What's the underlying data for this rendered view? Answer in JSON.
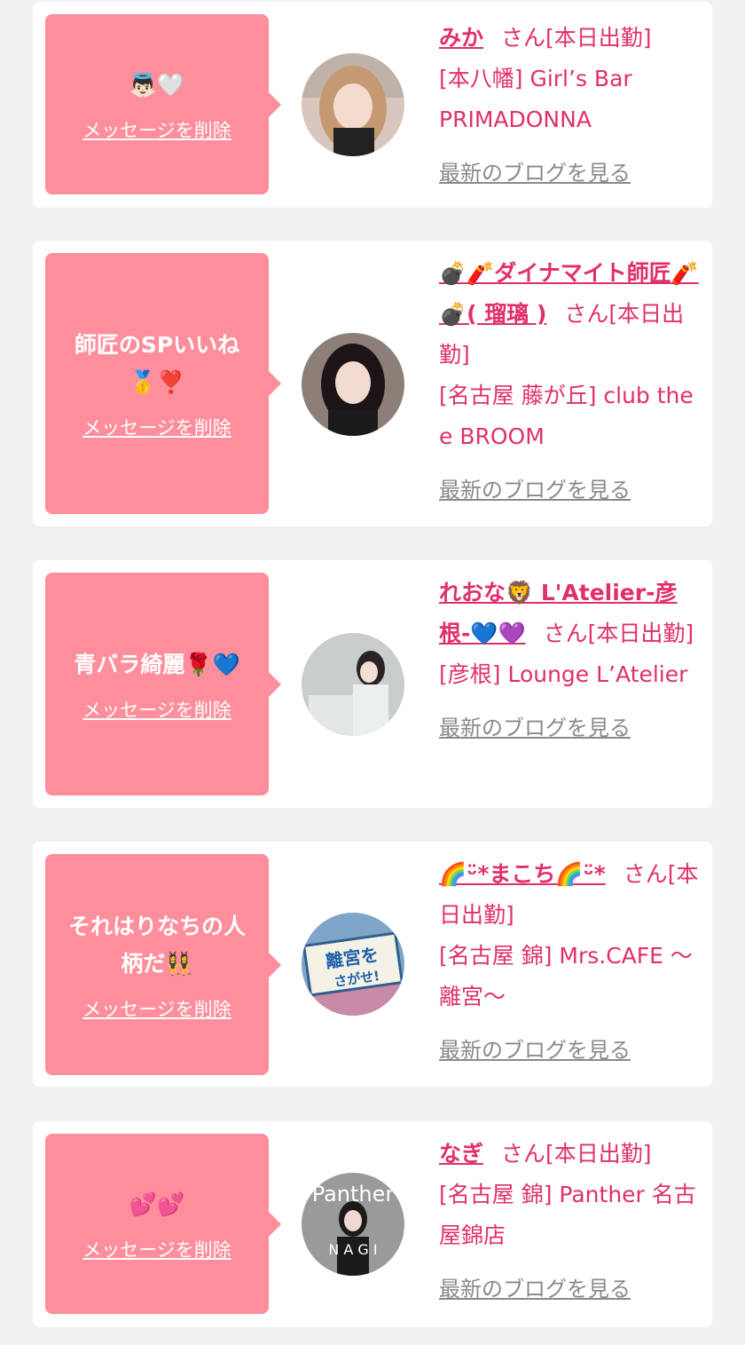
{
  "delete_label": "メッセージを削除",
  "blog_label": "最新のブログを見る",
  "entries": [
    {
      "message": "👼🏻🤍",
      "name": "みか",
      "suffix": "さん[本日出勤]",
      "shop": "[本八幡] Girl’s Bar PRIMADONNA"
    },
    {
      "message": "師匠のSPいいね🥇❣️",
      "name": "💣🧨ダイナマイト師匠🧨💣( 瑠璃 )",
      "suffix": "さん[本日出勤]",
      "shop": "[名古屋 藤が丘] club the e BROOM"
    },
    {
      "message": "青バラ綺麗🌹💙",
      "name": "れおな🦁 L'Atelier-彦根-💙💜",
      "suffix": "さん[本日出勤]",
      "shop": "[彦根] Lounge L’Atelier"
    },
    {
      "message": "それはりなちの人柄だ👯‍♀️",
      "name": "🌈ᵕ̈*まこち🌈ᵕ̈*",
      "suffix": "さん[本日出勤]",
      "shop": "[名古屋 錦] Mrs.CAFE ～離宮～"
    },
    {
      "message": "💕💕",
      "name": "なぎ",
      "suffix": "さん[本日出勤]",
      "shop": "[名古屋 錦] Panther 名古屋錦店"
    }
  ],
  "avatar4": {
    "line1": "離宮を",
    "line2": "さがせ!"
  },
  "avatar5": {
    "line1": "Panther",
    "line2": "N A G I"
  },
  "colors": {
    "bubble": "#fe8e9c",
    "name": "#e0306a",
    "background": "#f1f1f1"
  }
}
